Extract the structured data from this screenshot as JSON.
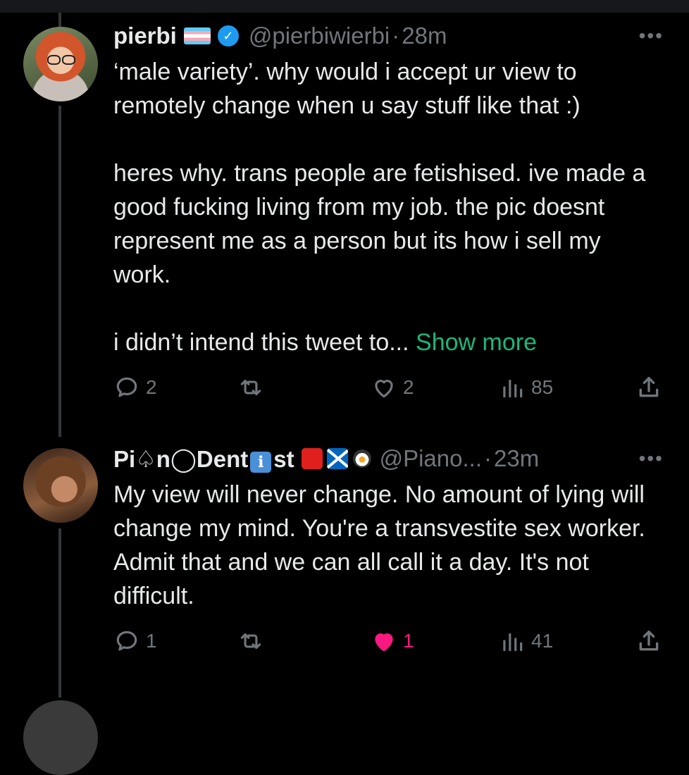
{
  "tweets": [
    {
      "name": "pierbi",
      "handle": "@pierbiwierbi",
      "time": "28m",
      "text_main": "‘male variety’. why would i accept ur view to remotely change when u say stuff like that :)\n\nheres why. trans people are fetishised. ive made a good fucking living from my job. the pic doesnt represent me as a person but its how i sell my work.\n\ni didn’t intend this tweet to... ",
      "show_more": "Show more",
      "replies": "2",
      "retweets": "",
      "likes": "2",
      "views": "85",
      "liked": false
    },
    {
      "name_parts": [
        "Pi",
        "♤",
        "n",
        "◯",
        "Dent",
        "ℹ",
        "st"
      ],
      "handle": "@Piano...",
      "time": "23m",
      "text_main": "My view will never change. No amount of lying will change my mind. You're a transvestite sex worker. Admit that and we can all call it a day. It's not difficult.",
      "replies": "1",
      "retweets": "",
      "likes": "1",
      "views": "41",
      "liked": true
    }
  ],
  "colors": {
    "background": "#000000",
    "text": "#e7e9ea",
    "muted": "#71767b",
    "verified": "#1d9bf0",
    "like": "#f91880",
    "show_more": "#1ab87a"
  },
  "icons": [
    "reply-icon",
    "retweet-icon",
    "like-icon",
    "views-icon",
    "share-icon",
    "more-icon",
    "verified-badge-icon"
  ]
}
